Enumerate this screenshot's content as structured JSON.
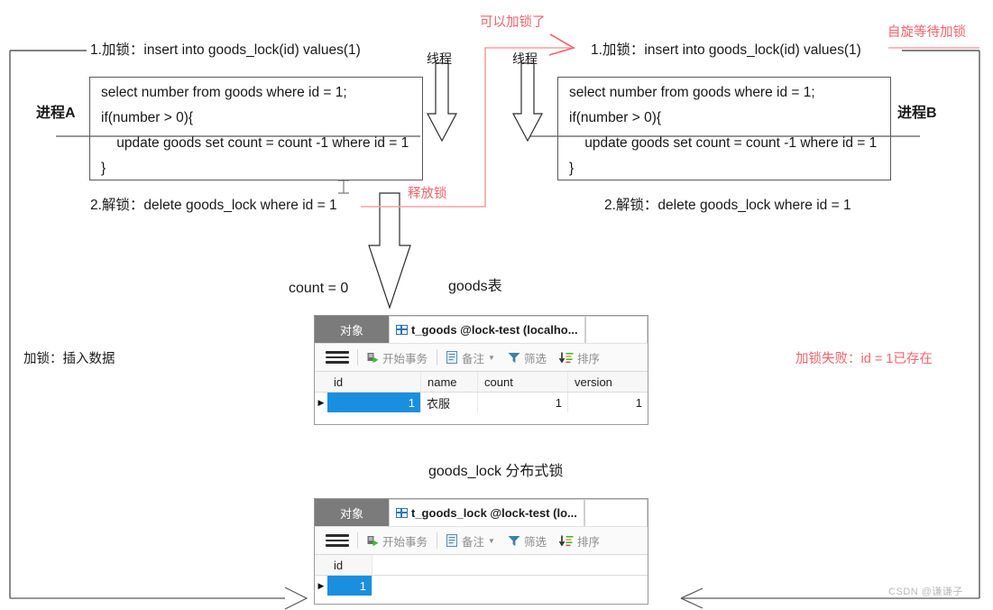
{
  "diagram": {
    "title": "distributed-lock-sequence-diagram",
    "colors": {
      "red": "#f5646a",
      "line": "#595959",
      "select_blue": "#1a8fe0",
      "tab_gray": "#7b7b7b"
    },
    "left_process_label": "进程A",
    "right_process_label": "进程B",
    "left_lock_step": "1.加锁：insert into goods_lock(id) values(1)",
    "left_unlock_step": "2.解锁：delete goods_lock where id = 1",
    "right_lock_step": "1.加锁：insert into goods_lock(id) values(1)",
    "right_unlock_step": "2.解锁：delete goods_lock where id = 1",
    "thread_label_left": "线程",
    "thread_label_right": "线程",
    "annotation_can_lock": "可以加锁了",
    "annotation_release_lock": "释放锁",
    "annotation_spin_wait": "自旋等待加锁",
    "annotation_lock_insert": "加锁：插入数据",
    "annotation_lock_failed": "加锁失败：id = 1已存在",
    "count_label": "count = 0",
    "goods_table_label": "goods表",
    "goods_lock_table_label": "goods_lock 分布式锁",
    "watermark": "CSDN @谦谦子"
  },
  "code_block_left": {
    "lines": [
      "select number from goods where id = 1;",
      "if(number > 0){",
      "    update goods set count = count -1 where id = 1",
      "}"
    ]
  },
  "code_block_right": {
    "lines": [
      "select number from goods where id = 1;",
      "if(number > 0){",
      "    update goods set count = count -1 where id = 1",
      "}"
    ]
  },
  "goods_grid": {
    "object_tab_label": "对象",
    "table_tab_label": "t_goods @lock-test (localho...",
    "toolbar": {
      "begin_transaction": "开始事务",
      "note": "备注",
      "filter": "筛选",
      "sort": "排序"
    },
    "columns": [
      "id",
      "name",
      "count",
      "version"
    ],
    "rows": [
      {
        "id": "1",
        "name": "衣服",
        "count": "1",
        "version": "1"
      }
    ]
  },
  "goods_lock_grid": {
    "object_tab_label": "对象",
    "table_tab_label": "t_goods_lock @lock-test (lo...",
    "toolbar": {
      "begin_transaction": "开始事务",
      "note": "备注",
      "filter": "筛选",
      "sort": "排序"
    },
    "columns": [
      "id"
    ],
    "rows": [
      {
        "id": "1"
      }
    ]
  }
}
